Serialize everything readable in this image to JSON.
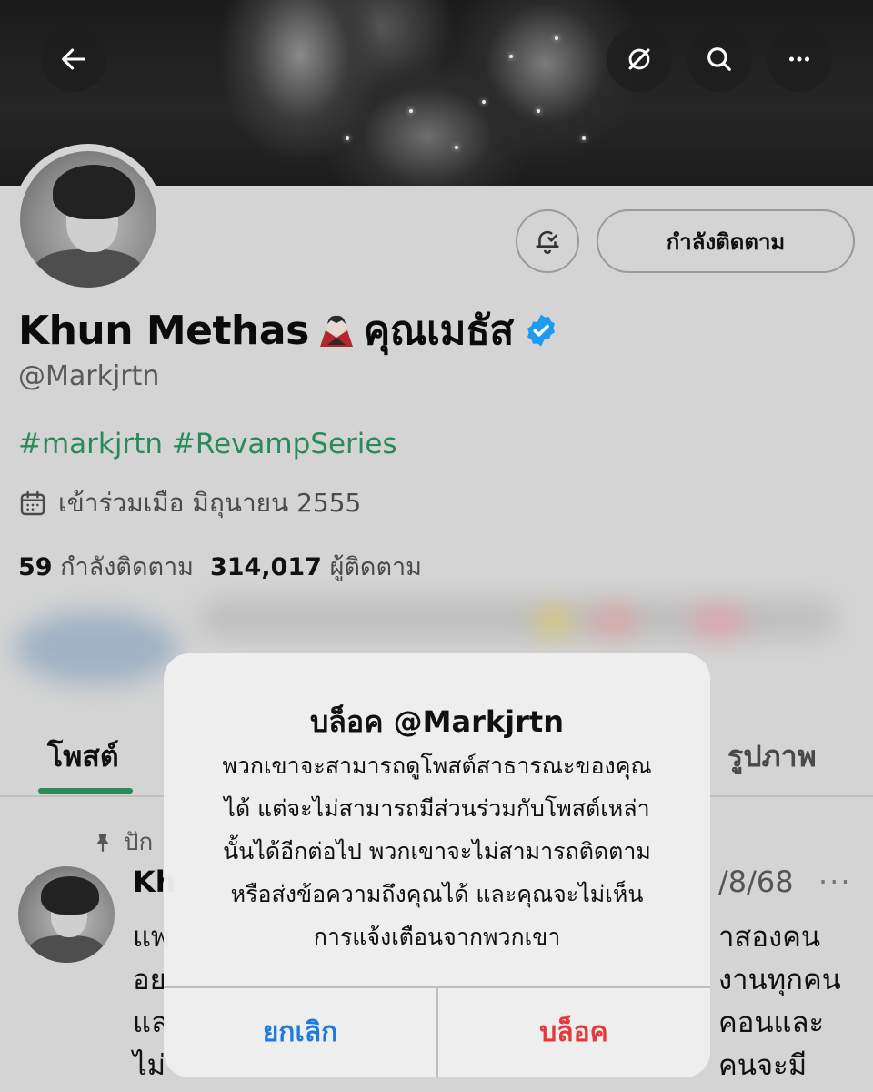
{
  "header": {
    "back_icon": "arrow-left-icon",
    "icons": [
      "grok-icon",
      "search-icon",
      "more-icon"
    ]
  },
  "profile": {
    "name": "Khun Methas",
    "name_emoji": "vampire-emoji",
    "name_thai": "คุณเมธัส",
    "verified_color": "#1d9bf0",
    "handle": "@Markjrtn",
    "hashtags": "#markjrtn #RevampSeries",
    "joined": "เข้าร่วมเมือ มิถุนายน 2555",
    "following_count": "59",
    "following_label": "กำลังติดตาม",
    "followers_count": "314,017",
    "followers_label": "ผู้ติดตาม",
    "follow_button": "กำลังติดตาม",
    "accent_color": "#2b8a5a"
  },
  "tabs": {
    "left": "โพสต์",
    "right": "รูปภาพ"
  },
  "post": {
    "pinned_label": "ปัก",
    "author_partial": "Kh",
    "date_partial": "/8/68",
    "more": "···",
    "line1_start": "แพ",
    "line1_end": "าสองคน",
    "line2_start": "อย",
    "line2_end": "งานทุกคน",
    "line3_start": "แล",
    "line3_end": "คอนและ",
    "line4_start": "ไม่",
    "line4_end": "คนจะมี"
  },
  "alert": {
    "title": "บล็อค @Markjrtn",
    "message_lines": [
      "พวกเขาจะสามารถดูโพสต์สาธารณะของคุณ",
      "ได้ แต่จะไม่สามารถมีส่วนร่วมกับโพสต์เหล่า",
      "นั้นได้อีกต่อไป พวกเขาจะไม่สามารถติดตาม",
      "หรือส่งข้อความถึงคุณได้ และคุณจะไม่เห็น",
      "การแจ้งเตือนจากพวกเขา"
    ],
    "cancel": "ยกเลิก",
    "confirm": "บล็อค",
    "cancel_color": "#1f7ae0",
    "confirm_color": "#e23a3a"
  }
}
